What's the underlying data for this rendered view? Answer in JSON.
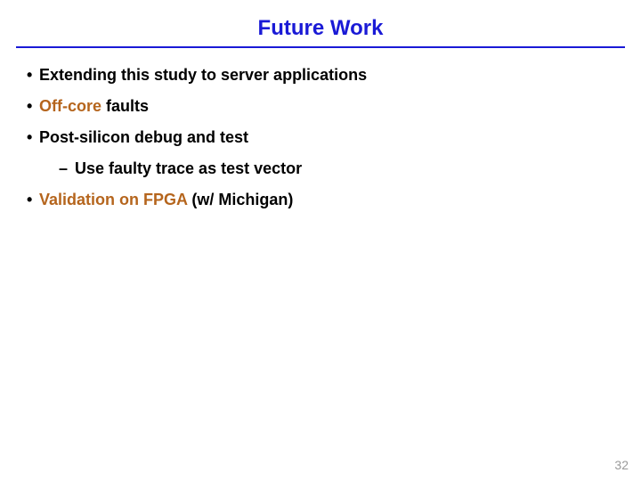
{
  "title": "Future Work",
  "bullets": {
    "b0": "Extending this study to server applications",
    "b1_pre": "Off-core",
    "b1_post": " faults",
    "b2": "Post-silicon debug and test",
    "b2_sub0": "Use faulty trace as test vector",
    "b3_pre": "Validation on FPGA",
    "b3_post": " (w/ Michigan)"
  },
  "page_number": "32"
}
